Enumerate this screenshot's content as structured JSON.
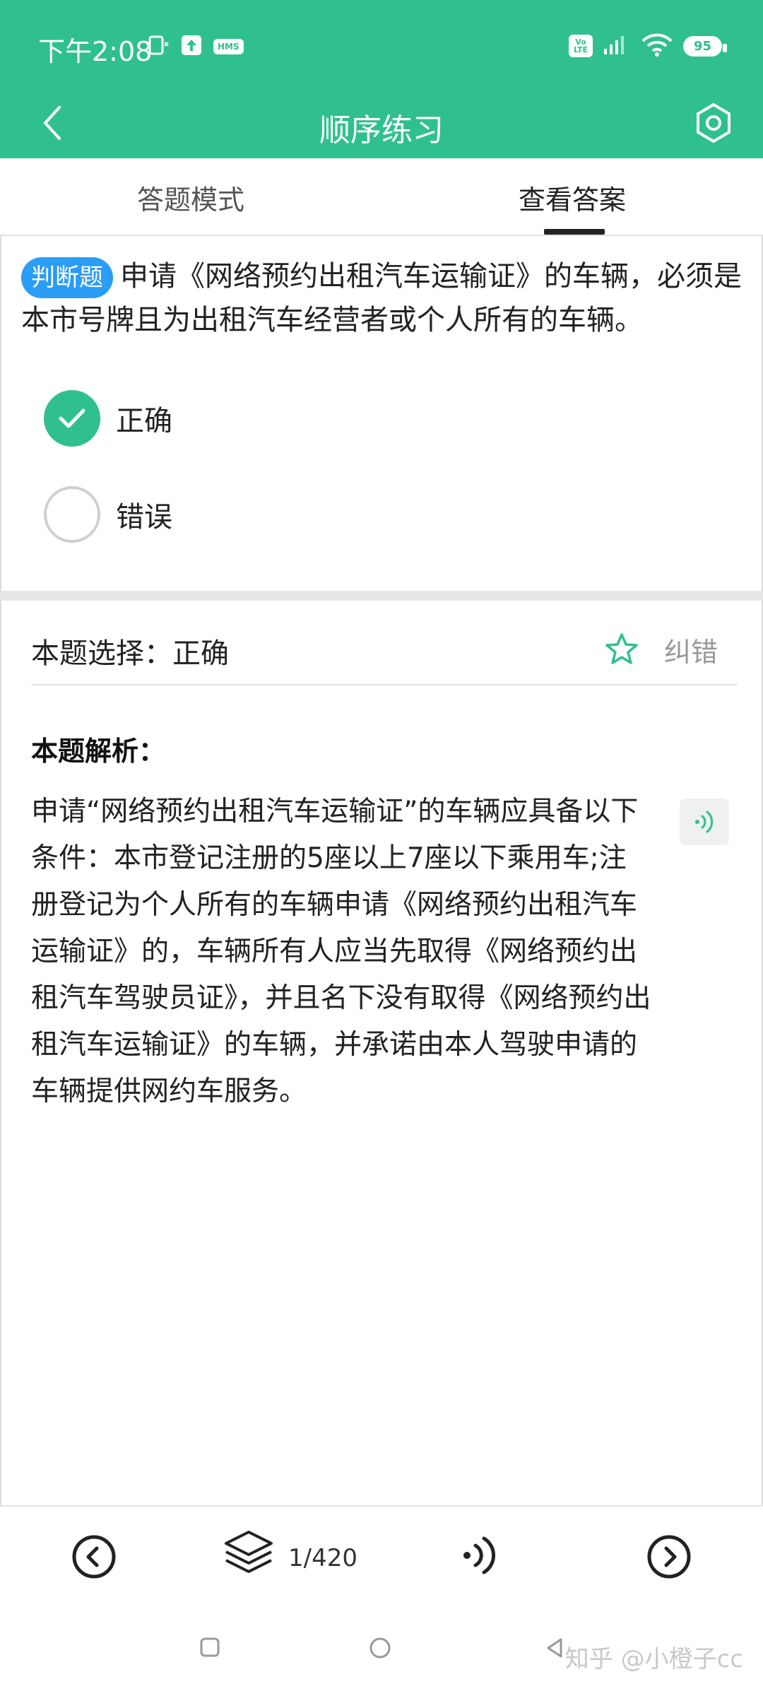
{
  "status_bar": {
    "time": "下午2:08",
    "hms": "HMS",
    "volte": "Vo LTE",
    "battery": "95"
  },
  "app_bar": {
    "title": "顺序练习"
  },
  "tabs": [
    {
      "label": "答题模式",
      "active": false
    },
    {
      "label": "查看答案",
      "active": true
    }
  ],
  "question": {
    "type_badge": "判断题",
    "text": "申请《网络预约出租汽车运输证》的车辆，必须是本市号牌且为出租汽车经营者或个人所有的车辆。",
    "options": [
      {
        "label": "正确",
        "selected": true
      },
      {
        "label": "错误",
        "selected": false
      }
    ]
  },
  "answer": {
    "choice_text": "本题选择：正确",
    "report_label": "纠错",
    "analysis_title": "本题解析：",
    "analysis_text": "申请“网络预约出租汽车运输证”的车辆应具备以下条件：本市登记注册的5座以上7座以下乘用车;注册登记为个人所有的车辆申请《网络预约出租汽车运输证》的，车辆所有人应当先取得《网络预约出租汽车驾驶员证》，并且名下没有取得《网络预约出租汽车运输证》的车辆，并承诺由本人驾驶申请的车辆提供网约车服务。"
  },
  "bottom_bar": {
    "progress": "1/420"
  },
  "watermark": "知乎 @小橙子cc",
  "colors": {
    "accent": "#2fc08e",
    "badge": "#2a9df4"
  }
}
